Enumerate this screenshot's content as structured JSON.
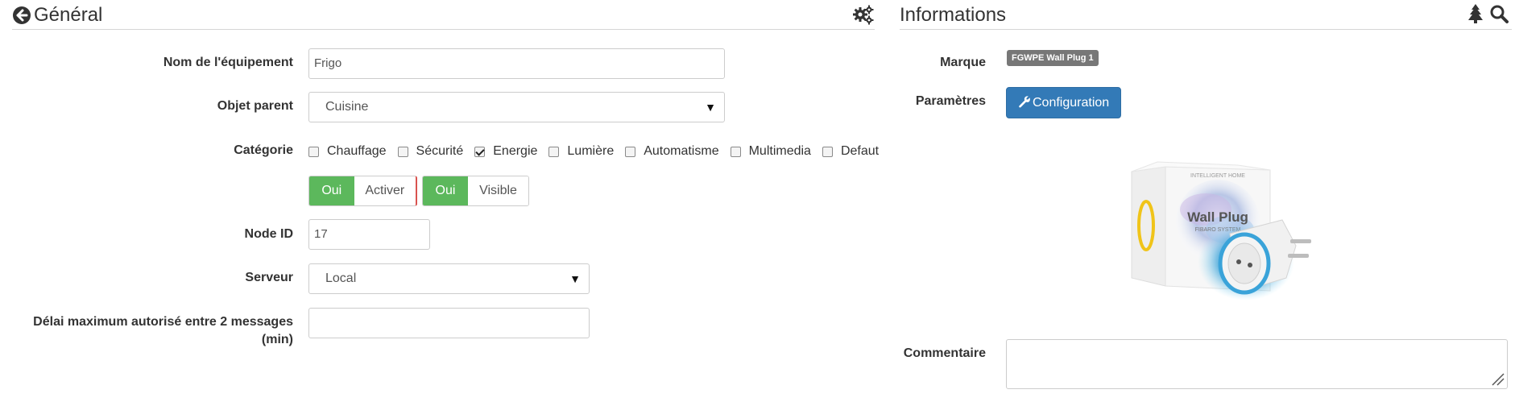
{
  "general": {
    "title": "Général",
    "back_icon": "arrow-circle-left-icon",
    "settings_icon": "gears-icon",
    "name_label": "Nom de l'équipement",
    "name_value": "Frigo",
    "parent_label": "Objet parent",
    "parent_value": "Cuisine",
    "category_label": "Catégorie",
    "categories": [
      {
        "label": "Chauffage",
        "checked": false
      },
      {
        "label": "Sécurité",
        "checked": false
      },
      {
        "label": "Energie",
        "checked": true
      },
      {
        "label": "Lumière",
        "checked": false
      },
      {
        "label": "Automatisme",
        "checked": false
      },
      {
        "label": "Multimedia",
        "checked": false
      },
      {
        "label": "Defaut",
        "checked": false
      }
    ],
    "toggle_enable": {
      "on": "Oui",
      "off": "Activer"
    },
    "toggle_visible": {
      "on": "Oui",
      "off": "Visible"
    },
    "node_label": "Node ID",
    "node_value": "17",
    "server_label": "Serveur",
    "server_value": "Local",
    "delay_label_line1": "Délai maximum autorisé entre 2 messages",
    "delay_label_line2": "(min)",
    "delay_value": ""
  },
  "info": {
    "title": "Informations",
    "tree_icon": "tree-icon",
    "search_icon": "search-icon",
    "brand_label": "Marque",
    "brand_badge": "FGWPE Wall Plug 1",
    "params_label": "Paramètres",
    "config_button": "Configuration",
    "product_box_line1": "Wall Plug",
    "product_box_line2": "FIBARO SYSTEM",
    "product_box_top": "INTELLIGENT HOME",
    "comment_label": "Commentaire",
    "comment_value": "",
    "colors": {
      "accent": "#337ab7",
      "success": "#5cb85c",
      "badge": "#777777",
      "danger_edge": "#d9534f"
    }
  }
}
